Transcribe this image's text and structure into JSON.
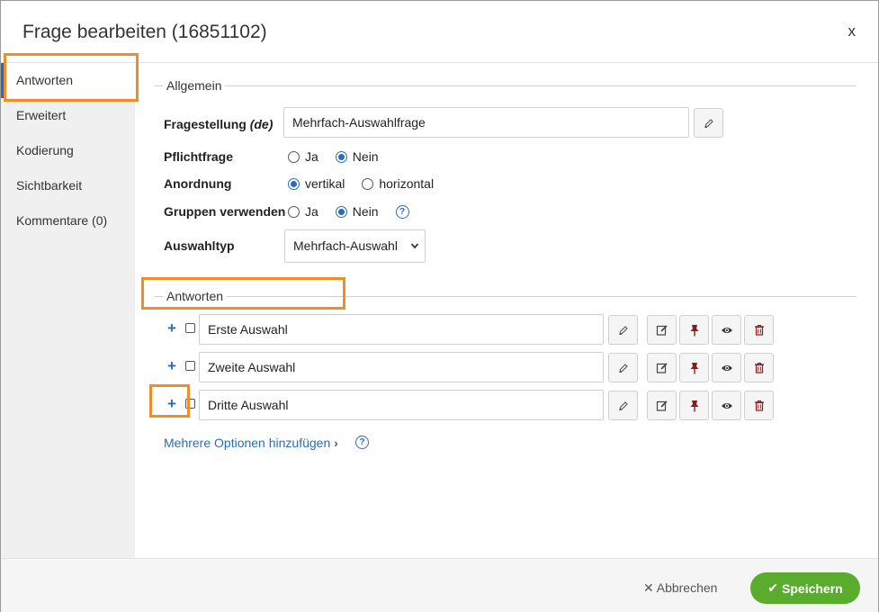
{
  "dialog": {
    "title": "Frage bearbeiten (16851102)",
    "close_label": "x"
  },
  "sidebar": {
    "items": [
      {
        "label": "Antworten"
      },
      {
        "label": "Erweitert"
      },
      {
        "label": "Kodierung"
      },
      {
        "label": "Sichtbarkeit"
      },
      {
        "label": "Kommentare (0)"
      }
    ]
  },
  "general": {
    "section_label": "Allgemein",
    "question_label": "Fragestellung",
    "question_lang": "(de)",
    "question_value": "Mehrfach-Auswahlfrage",
    "required_label": "Pflichtfrage",
    "required_yes": "Ja",
    "required_no": "Nein",
    "layout_label": "Anordnung",
    "layout_vertical": "vertikal",
    "layout_horizontal": "horizontal",
    "groups_label": "Gruppen verwenden",
    "groups_yes": "Ja",
    "groups_no": "Nein",
    "type_label": "Auswahltyp",
    "type_value": "Mehrfach-Auswahl"
  },
  "answers": {
    "section_label": "Antworten",
    "items": [
      {
        "label": "Erste Auswahl"
      },
      {
        "label": "Zweite Auswahl"
      },
      {
        "label": "Dritte Auswahl"
      }
    ],
    "add_multiple_link": "Mehrere Optionen hinzufügen",
    "add_multiple_chevron": "›"
  },
  "footer": {
    "cancel_label": "Abbrechen",
    "save_label": "Speichern"
  },
  "colors": {
    "accent": "#2b6cb8",
    "save_green": "#5aac2c",
    "highlight_orange": "#f28c28",
    "pin_red": "#8b1a1a"
  }
}
